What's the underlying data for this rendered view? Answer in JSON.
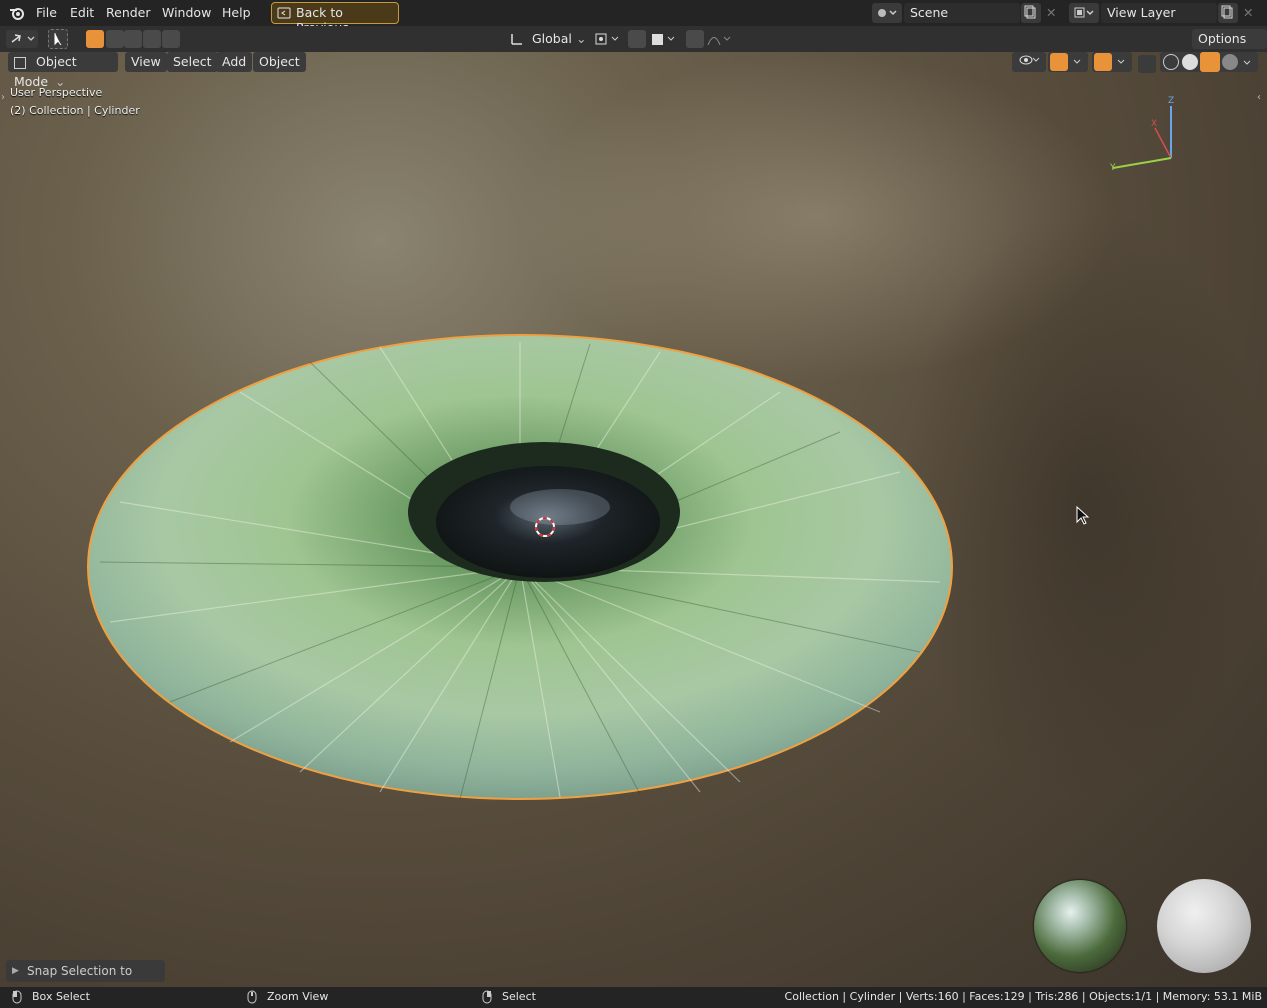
{
  "menu": {
    "file": "File",
    "edit": "Edit",
    "render": "Render",
    "window": "Window",
    "help": "Help",
    "back": "Back to Previous"
  },
  "scene": {
    "name": "Scene"
  },
  "view_layer": {
    "name": "View Layer"
  },
  "toolbar": {
    "orientation": "Global",
    "options": "Options"
  },
  "viewport_header": {
    "mode": "Object Mode",
    "view": "View",
    "select": "Select",
    "add": "Add",
    "object": "Object"
  },
  "overlay": {
    "perspective": "User Perspective",
    "collection": "(2) Collection | Cylinder"
  },
  "gizmo": {
    "z": "Z",
    "x": "X",
    "y": "Y"
  },
  "last_operation": "Snap Selection to Cursor",
  "status": {
    "box_select": "Box Select",
    "zoom_view": "Zoom View",
    "select": "Select",
    "stats": "Collection | Cylinder | Verts:160 | Faces:129 | Tris:286 | Objects:1/1 | Memory: 53.1 MiB"
  },
  "colors": {
    "accent_orange": "#e8923a",
    "iris_green": "#8fbf8a",
    "selection_outline": "#f0a040"
  }
}
